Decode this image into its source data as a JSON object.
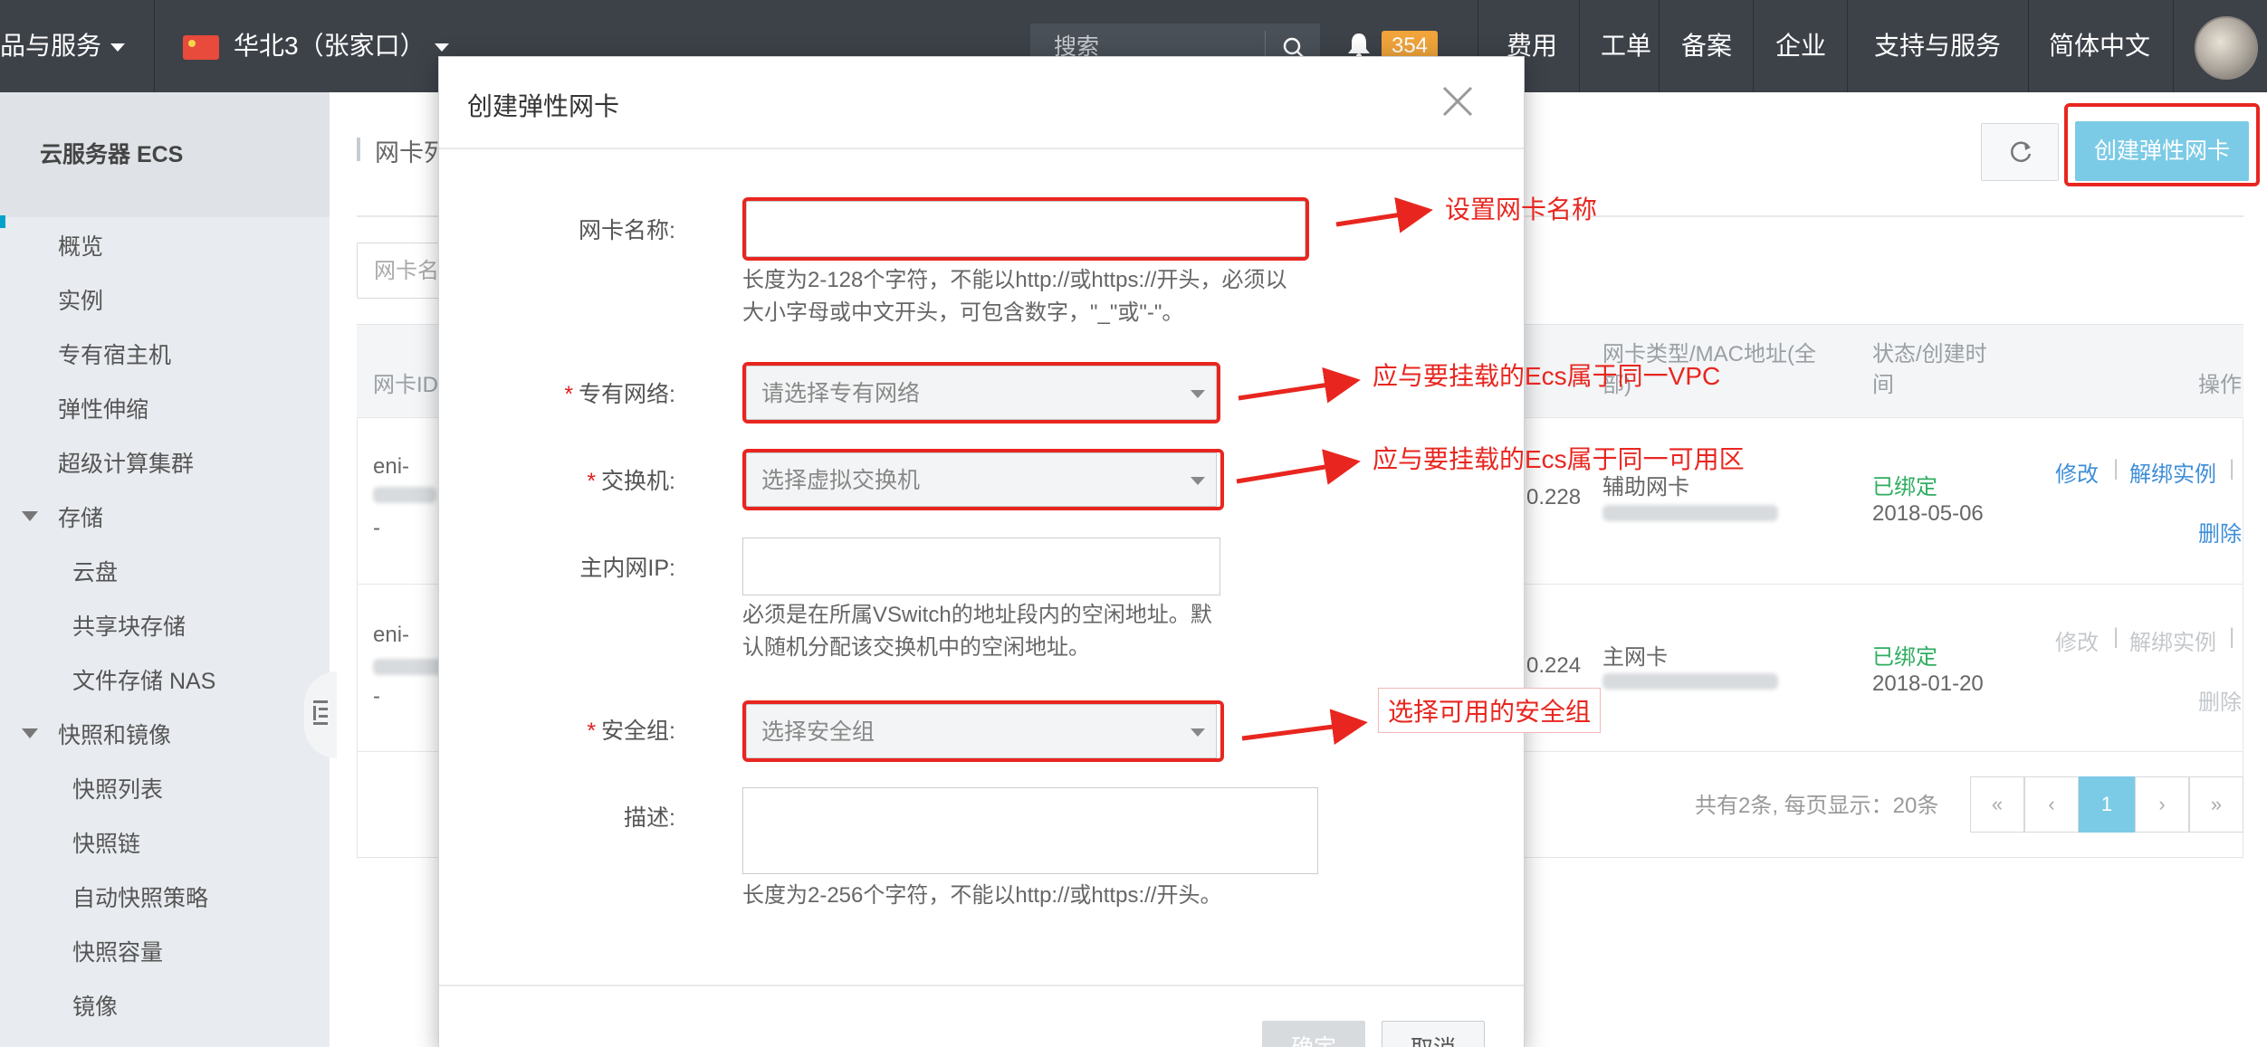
{
  "topbar": {
    "products": "品与服务",
    "region": "华北3（张家口）",
    "search_placeholder": "搜索",
    "notification_count": "354",
    "nav": [
      "费用",
      "工单",
      "备案",
      "企业",
      "支持与服务",
      "简体中文"
    ]
  },
  "sidebar": {
    "title": "云服务器 ECS",
    "items": [
      "概览",
      "实例",
      "专有宿主机",
      "弹性伸缩",
      "超级计算集群"
    ],
    "storage": {
      "label": "存储",
      "items": [
        "云盘",
        "共享块存储",
        "文件存储 NAS"
      ]
    },
    "snapshot": {
      "label": "快照和镜像",
      "items": [
        "快照列表",
        "快照链",
        "自动快照策略",
        "快照容量",
        "镜像"
      ]
    }
  },
  "page": {
    "breadcrumb": "网卡列",
    "create_button": "创建弹性网卡",
    "filter_placeholder": "网卡名",
    "table": {
      "headers": {
        "id": "网卡ID/",
        "type_mac": "网卡类型/MAC地址(全部)",
        "status_time": "状态/创建时间",
        "ops": "操作"
      },
      "rows": [
        {
          "id_top": "eni-",
          "id_bottom": "-",
          "ip_tail": "0.228",
          "type": "辅助网卡",
          "status": "已绑定",
          "date": "2018-05-06",
          "op_edit": "修改",
          "op_unbind": "解绑实例",
          "op_delete": "删除"
        },
        {
          "id_top": "eni-",
          "id_bottom": "-",
          "ip_tail": "0.224",
          "type": "主网卡",
          "status": "已绑定",
          "date": "2018-01-20",
          "op_edit": "修改",
          "op_unbind": "解绑实例",
          "op_delete": "删除"
        }
      ]
    },
    "pagination": {
      "summary": "共有2条, 每页显示：20条",
      "first": "«",
      "prev": "‹",
      "current": "1",
      "next": "›",
      "last": "»"
    }
  },
  "modal": {
    "title": "创建弹性网卡",
    "fields": {
      "name": {
        "label": "网卡名称:",
        "hint": "长度为2-128个字符，不能以http://或https://开头，必须以大小字母或中文开头，可包含数字，\"_\"或\"-\"。"
      },
      "vpc": {
        "required": "*",
        "label": "专有网络:",
        "placeholder": "请选择专有网络"
      },
      "vswitch": {
        "required": "*",
        "label": "交换机:",
        "placeholder": "选择虚拟交换机"
      },
      "private_ip": {
        "label": "主内网IP:",
        "hint": "必须是在所属VSwitch的地址段内的空闲地址。默认随机分配该交换机中的空闲地址。"
      },
      "security_group": {
        "required": "*",
        "label": "安全组:",
        "placeholder": "选择安全组"
      },
      "description": {
        "label": "描述:",
        "hint": "长度为2-256个字符，不能以http://或https://开头。"
      }
    },
    "confirm_button": "确定",
    "cancel_button": "取消"
  },
  "annotations": {
    "name": "设置网卡名称",
    "vpc": "应与要挂载的Ecs属于同一VPC",
    "vswitch": "应与要挂载的Ecs属于同一可用区",
    "security_group": "选择可用的安全组"
  },
  "colors": {
    "annotation_red": "#e8261f",
    "accent": "#7ccbe6",
    "topbar": "#3d4249",
    "status_green": "#2fae61"
  }
}
